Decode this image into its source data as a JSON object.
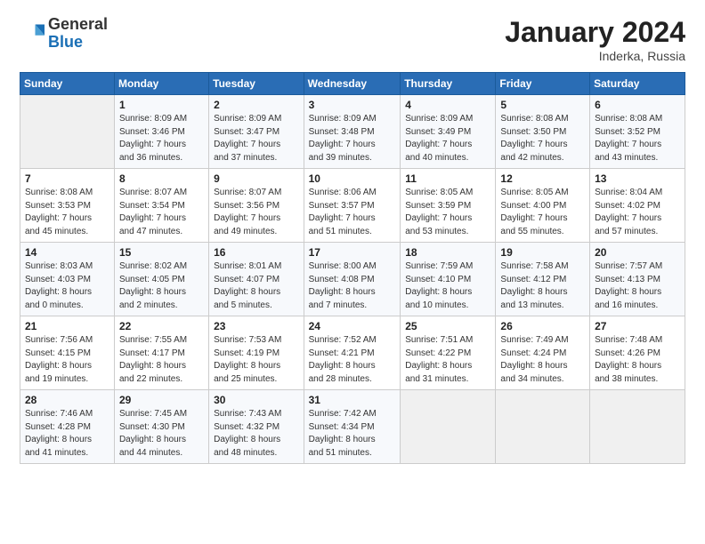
{
  "header": {
    "logo_general": "General",
    "logo_blue": "Blue",
    "month": "January 2024",
    "location": "Inderka, Russia"
  },
  "weekdays": [
    "Sunday",
    "Monday",
    "Tuesday",
    "Wednesday",
    "Thursday",
    "Friday",
    "Saturday"
  ],
  "weeks": [
    [
      {
        "day": "",
        "info": ""
      },
      {
        "day": "1",
        "info": "Sunrise: 8:09 AM\nSunset: 3:46 PM\nDaylight: 7 hours\nand 36 minutes."
      },
      {
        "day": "2",
        "info": "Sunrise: 8:09 AM\nSunset: 3:47 PM\nDaylight: 7 hours\nand 37 minutes."
      },
      {
        "day": "3",
        "info": "Sunrise: 8:09 AM\nSunset: 3:48 PM\nDaylight: 7 hours\nand 39 minutes."
      },
      {
        "day": "4",
        "info": "Sunrise: 8:09 AM\nSunset: 3:49 PM\nDaylight: 7 hours\nand 40 minutes."
      },
      {
        "day": "5",
        "info": "Sunrise: 8:08 AM\nSunset: 3:50 PM\nDaylight: 7 hours\nand 42 minutes."
      },
      {
        "day": "6",
        "info": "Sunrise: 8:08 AM\nSunset: 3:52 PM\nDaylight: 7 hours\nand 43 minutes."
      }
    ],
    [
      {
        "day": "7",
        "info": "Sunrise: 8:08 AM\nSunset: 3:53 PM\nDaylight: 7 hours\nand 45 minutes."
      },
      {
        "day": "8",
        "info": "Sunrise: 8:07 AM\nSunset: 3:54 PM\nDaylight: 7 hours\nand 47 minutes."
      },
      {
        "day": "9",
        "info": "Sunrise: 8:07 AM\nSunset: 3:56 PM\nDaylight: 7 hours\nand 49 minutes."
      },
      {
        "day": "10",
        "info": "Sunrise: 8:06 AM\nSunset: 3:57 PM\nDaylight: 7 hours\nand 51 minutes."
      },
      {
        "day": "11",
        "info": "Sunrise: 8:05 AM\nSunset: 3:59 PM\nDaylight: 7 hours\nand 53 minutes."
      },
      {
        "day": "12",
        "info": "Sunrise: 8:05 AM\nSunset: 4:00 PM\nDaylight: 7 hours\nand 55 minutes."
      },
      {
        "day": "13",
        "info": "Sunrise: 8:04 AM\nSunset: 4:02 PM\nDaylight: 7 hours\nand 57 minutes."
      }
    ],
    [
      {
        "day": "14",
        "info": "Sunrise: 8:03 AM\nSunset: 4:03 PM\nDaylight: 8 hours\nand 0 minutes."
      },
      {
        "day": "15",
        "info": "Sunrise: 8:02 AM\nSunset: 4:05 PM\nDaylight: 8 hours\nand 2 minutes."
      },
      {
        "day": "16",
        "info": "Sunrise: 8:01 AM\nSunset: 4:07 PM\nDaylight: 8 hours\nand 5 minutes."
      },
      {
        "day": "17",
        "info": "Sunrise: 8:00 AM\nSunset: 4:08 PM\nDaylight: 8 hours\nand 7 minutes."
      },
      {
        "day": "18",
        "info": "Sunrise: 7:59 AM\nSunset: 4:10 PM\nDaylight: 8 hours\nand 10 minutes."
      },
      {
        "day": "19",
        "info": "Sunrise: 7:58 AM\nSunset: 4:12 PM\nDaylight: 8 hours\nand 13 minutes."
      },
      {
        "day": "20",
        "info": "Sunrise: 7:57 AM\nSunset: 4:13 PM\nDaylight: 8 hours\nand 16 minutes."
      }
    ],
    [
      {
        "day": "21",
        "info": "Sunrise: 7:56 AM\nSunset: 4:15 PM\nDaylight: 8 hours\nand 19 minutes."
      },
      {
        "day": "22",
        "info": "Sunrise: 7:55 AM\nSunset: 4:17 PM\nDaylight: 8 hours\nand 22 minutes."
      },
      {
        "day": "23",
        "info": "Sunrise: 7:53 AM\nSunset: 4:19 PM\nDaylight: 8 hours\nand 25 minutes."
      },
      {
        "day": "24",
        "info": "Sunrise: 7:52 AM\nSunset: 4:21 PM\nDaylight: 8 hours\nand 28 minutes."
      },
      {
        "day": "25",
        "info": "Sunrise: 7:51 AM\nSunset: 4:22 PM\nDaylight: 8 hours\nand 31 minutes."
      },
      {
        "day": "26",
        "info": "Sunrise: 7:49 AM\nSunset: 4:24 PM\nDaylight: 8 hours\nand 34 minutes."
      },
      {
        "day": "27",
        "info": "Sunrise: 7:48 AM\nSunset: 4:26 PM\nDaylight: 8 hours\nand 38 minutes."
      }
    ],
    [
      {
        "day": "28",
        "info": "Sunrise: 7:46 AM\nSunset: 4:28 PM\nDaylight: 8 hours\nand 41 minutes."
      },
      {
        "day": "29",
        "info": "Sunrise: 7:45 AM\nSunset: 4:30 PM\nDaylight: 8 hours\nand 44 minutes."
      },
      {
        "day": "30",
        "info": "Sunrise: 7:43 AM\nSunset: 4:32 PM\nDaylight: 8 hours\nand 48 minutes."
      },
      {
        "day": "31",
        "info": "Sunrise: 7:42 AM\nSunset: 4:34 PM\nDaylight: 8 hours\nand 51 minutes."
      },
      {
        "day": "",
        "info": ""
      },
      {
        "day": "",
        "info": ""
      },
      {
        "day": "",
        "info": ""
      }
    ]
  ]
}
